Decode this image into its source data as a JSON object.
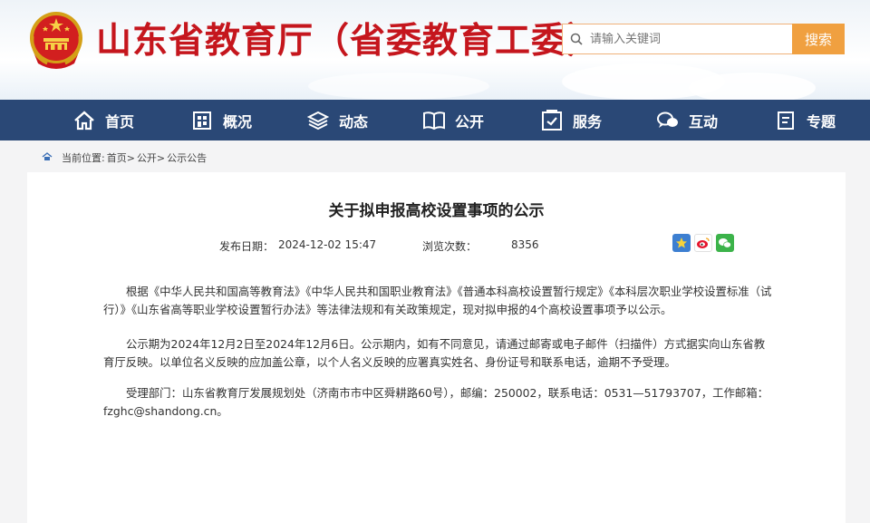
{
  "header": {
    "site_title": "山东省教育厅（省委教育工委）",
    "search_placeholder": "请输入关键词",
    "search_button": "搜索"
  },
  "nav": {
    "items": [
      {
        "label": "首页",
        "icon": "home-icon"
      },
      {
        "label": "概况",
        "icon": "building-icon"
      },
      {
        "label": "动态",
        "icon": "layers-icon"
      },
      {
        "label": "公开",
        "icon": "book-icon"
      },
      {
        "label": "服务",
        "icon": "service-icon"
      },
      {
        "label": "互动",
        "icon": "chat-icon"
      },
      {
        "label": "专题",
        "icon": "topic-icon"
      }
    ]
  },
  "breadcrumb": {
    "prefix": "当前位置:",
    "items": [
      "首页>",
      "公开>",
      "公示公告"
    ]
  },
  "article": {
    "title": "关于拟申报高校设置事项的公示",
    "publish_label": "发布日期：",
    "publish_date": "2024-12-02 15:47",
    "views_label": "浏览次数：",
    "views": "8356",
    "share_icons": [
      "star-share-icon",
      "weibo-icon",
      "wechat-icon"
    ],
    "paragraphs": [
      "根据《中华人民共和国高等教育法》《中华人民共和国职业教育法》《普通本科高校设置暂行规定》《本科层次职业学校设置标准（试行）》《山东省高等职业学校设置暂行办法》等法律法规和有关政策规定，现对拟申报的4个高校设置事项予以公示。",
      "公示期为2024年12月2日至2024年12月6日。公示期内，如有不同意见，请通过邮寄或电子邮件（扫描件）方式据实向山东省教育厅反映。以单位名义反映的应加盖公章，以个人名义反映的应署真实姓名、身份证号和联系电话，逾期不予受理。",
      "受理部门：山东省教育厅发展规划处（济南市市中区舜耕路60号），邮编：250002，联系电话：0531—51793707，工作邮箱：fzghc@shandong.cn。"
    ]
  },
  "colors": {
    "title_red": "#c5161d",
    "nav_blue": "#2a4876",
    "search_orange": "#f0a040"
  }
}
